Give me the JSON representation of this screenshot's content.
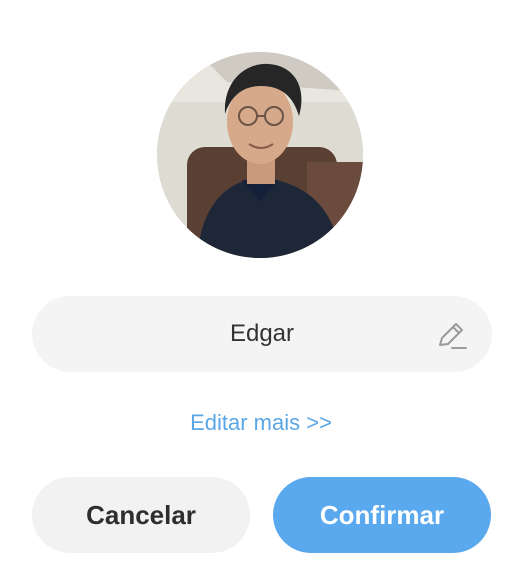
{
  "profile": {
    "avatar_icon": "profile-photo",
    "name": "Edgar",
    "edit_icon": "pencil-icon",
    "edit_more_label": "Editar mais >>"
  },
  "actions": {
    "cancel_label": "Cancelar",
    "confirm_label": "Confirmar"
  },
  "colors": {
    "accent": "#5aa8ee",
    "link": "#5aa6e6",
    "field_bg": "#f4f4f4",
    "cancel_bg": "#f2f2f2",
    "text": "#333333"
  }
}
